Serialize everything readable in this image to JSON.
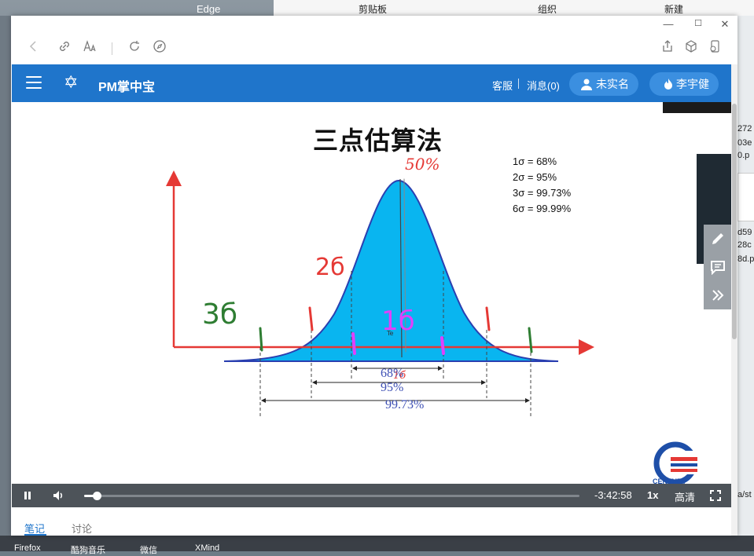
{
  "desktop": {
    "edge_label": "Edge",
    "ribbon": [
      "剪贴板",
      "组织",
      "新建"
    ],
    "taskbar": [
      "Firefox",
      "酷狗音乐",
      "微信",
      "XMind"
    ],
    "right_fragments": [
      "272",
      "03e",
      "0.p",
      "d59",
      "28c",
      "8d.p",
      "a/st"
    ]
  },
  "window": {
    "controls": {
      "minimize": "—",
      "maximize": "☐",
      "close": "✕"
    }
  },
  "toolbar": {
    "icons": [
      "back-icon",
      "link-icon",
      "read-aloud-icon",
      "refresh-icon",
      "compass-icon",
      "share-icon",
      "cube-icon",
      "phone-icon"
    ]
  },
  "appbar": {
    "brand": "PM掌中宝",
    "service": "客服",
    "messages": "消息(0)",
    "verify": "未实名",
    "user": "李宇健"
  },
  "slide": {
    "title": "三点估算法",
    "sigma_lines": [
      "1σ = 68%",
      "2σ = 95%",
      "3σ = 99.73%",
      "6σ = 99.99%"
    ],
    "ranges": [
      "68%",
      "95%",
      "99.73%"
    ],
    "annotations": {
      "top": "50%",
      "two_sigma": "2б",
      "three_sigma": "3б",
      "one_sigma": "1б",
      "center": "1б",
      "te": "Te"
    },
    "logo_text": "CENTURY"
  },
  "player": {
    "time_remaining": "-3:42:58",
    "speed": "1x",
    "quality": "高清",
    "progress": 0.025
  },
  "tabs": [
    {
      "label": "笔记",
      "active": true
    },
    {
      "label": "讨论",
      "active": false
    }
  ]
}
